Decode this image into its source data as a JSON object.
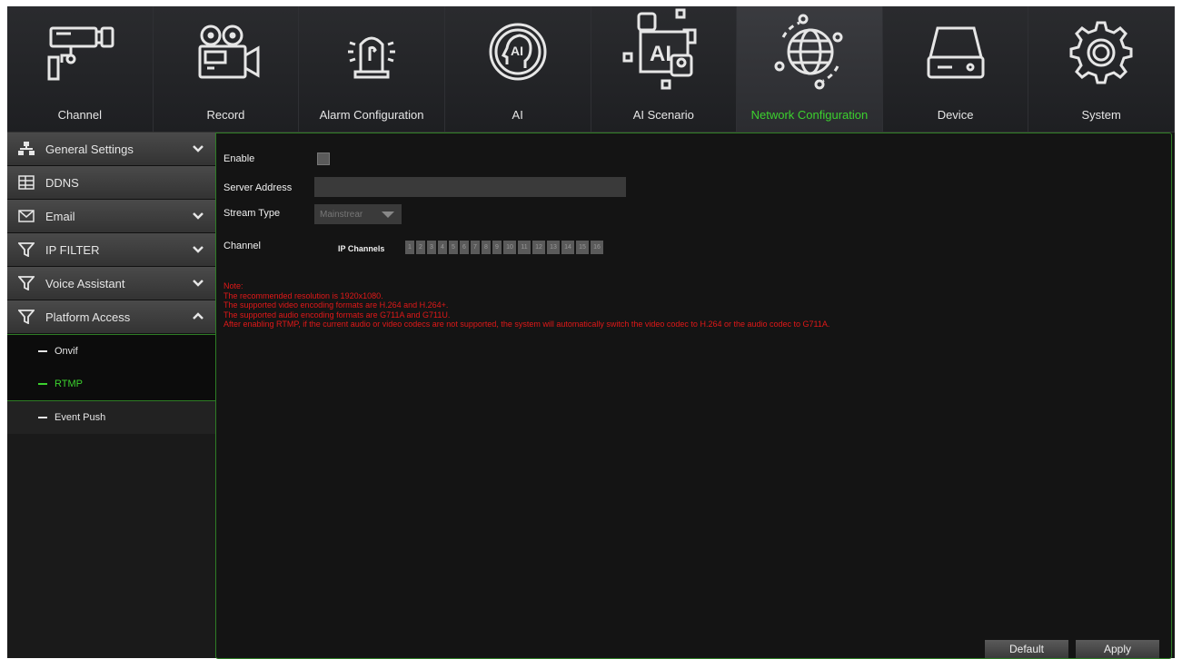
{
  "nav": {
    "tabs": [
      {
        "label": "Channel",
        "icon": "cctv-camera-icon"
      },
      {
        "label": "Record",
        "icon": "video-camera-icon"
      },
      {
        "label": "Alarm Configuration",
        "icon": "alarm-siren-icon"
      },
      {
        "label": "AI",
        "icon": "ai-head-icon"
      },
      {
        "label": "AI Scenario",
        "icon": "ai-scenario-icon"
      },
      {
        "label": "Network Configuration",
        "icon": "globe-network-icon",
        "active": true
      },
      {
        "label": "Device",
        "icon": "hard-drive-icon"
      },
      {
        "label": "System",
        "icon": "gear-icon"
      }
    ]
  },
  "sidebar": {
    "items": [
      {
        "label": "General Settings",
        "icon": "network-icon",
        "expandable": true
      },
      {
        "label": "DDNS",
        "icon": "ddns-icon"
      },
      {
        "label": "Email",
        "icon": "email-icon",
        "expandable": true
      },
      {
        "label": "IP FILTER",
        "icon": "filter-icon",
        "expandable": true
      },
      {
        "label": "Voice Assistant",
        "icon": "filter-icon",
        "expandable": true
      },
      {
        "label": "Platform Access",
        "icon": "filter-icon",
        "expanded": true
      }
    ],
    "subitems": [
      {
        "label": "Onvif"
      },
      {
        "label": "RTMP",
        "active": true
      },
      {
        "label": "Event Push"
      }
    ]
  },
  "form": {
    "enable_label": "Enable",
    "server_address_label": "Server Address",
    "server_address_value": "",
    "stream_type_label": "Stream Type",
    "stream_type_value": "Mainstrear",
    "channel_label": "Channel",
    "ip_channels_label": "IP Channels",
    "channels": [
      "1",
      "2",
      "3",
      "4",
      "5",
      "6",
      "7",
      "8",
      "9",
      "10",
      "11",
      "12",
      "13",
      "14",
      "15",
      "16"
    ]
  },
  "note": {
    "title": "Note:",
    "lines": [
      "The recommended resolution is 1920x1080.",
      "The supported video encoding formats are H.264 and H.264+.",
      "The supported audio encoding formats are G711A and G711U.",
      "After enabling RTMP, if the current audio or video codecs are not supported, the system will automatically switch the video codec to H.264 or the audio codec to G711A."
    ]
  },
  "buttons": {
    "default": "Default",
    "apply": "Apply"
  },
  "colors": {
    "accent": "#3cd12e",
    "note": "#e11818",
    "background": "#161616"
  }
}
